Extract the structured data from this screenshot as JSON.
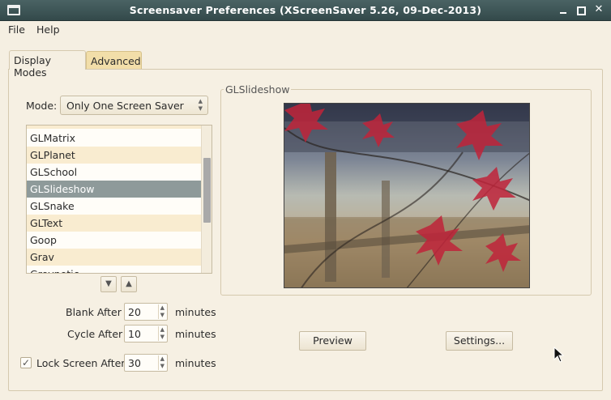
{
  "window": {
    "title": "Screensaver Preferences  (XScreenSaver 5.26, 09-Dec-2013)"
  },
  "menu": {
    "file": "File",
    "help": "Help"
  },
  "tabs": [
    {
      "label": "Display Modes",
      "active": true
    },
    {
      "label": "Advanced",
      "active": false
    }
  ],
  "mode": {
    "label": "Mode:",
    "value": "Only One Screen Saver"
  },
  "list": {
    "items": [
      "GLMatrix",
      "GLPlanet",
      "GLSchool",
      "GLSlideshow",
      "GLSnake",
      "GLText",
      "Goop",
      "Grav",
      "Greynetic"
    ],
    "selected": "GLSlideshow"
  },
  "blank": {
    "label": "Blank After",
    "value": "20",
    "unit": "minutes"
  },
  "cycle": {
    "label": "Cycle After",
    "value": "10",
    "unit": "minutes"
  },
  "lock": {
    "label": "Lock Screen After",
    "value": "30",
    "unit": "minutes",
    "checked": true
  },
  "preview_frame": {
    "label": "GLSlideshow"
  },
  "buttons": {
    "preview": "Preview",
    "settings": "Settings..."
  },
  "colors": {
    "titlebar": "#3f5657",
    "panel": "#f6f0e3",
    "selected_row": "#8e9a9a",
    "inactive_tab": "#f2dea9"
  },
  "icons": {
    "window": "window-icon",
    "minimize": "minimize-icon",
    "maximize": "maximize-icon",
    "close": "close-icon"
  }
}
